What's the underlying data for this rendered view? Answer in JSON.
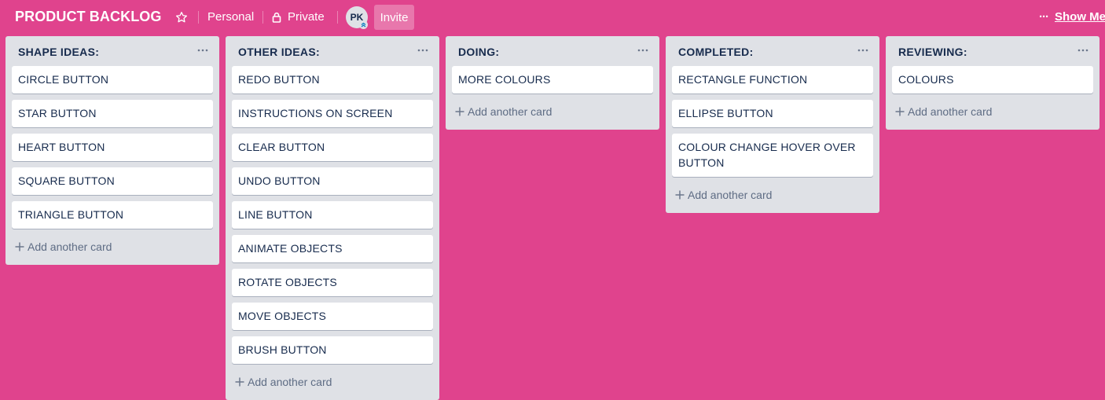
{
  "header": {
    "board_title": "PRODUCT BACKLOG",
    "personal_label": "Personal",
    "private_label": "Private",
    "avatar_initials": "PK",
    "invite_label": "Invite",
    "show_menu_label": "Show Me",
    "menu_dots": "···"
  },
  "colors": {
    "board_background": "#e0438d",
    "list_background": "#dfe1e6",
    "card_background": "#ffffff",
    "card_text": "#172b4d"
  },
  "add_card_label": "Add another card",
  "lists": [
    {
      "title": "SHAPE IDEAS:",
      "cards": [
        "CIRCLE BUTTON",
        "STAR BUTTON",
        "HEART BUTTON",
        "SQUARE BUTTON",
        "TRIANGLE BUTTON"
      ]
    },
    {
      "title": "OTHER IDEAS:",
      "cards": [
        "REDO BUTTON",
        "INSTRUCTIONS ON SCREEN",
        "CLEAR BUTTON",
        "UNDO BUTTON",
        "LINE BUTTON",
        "ANIMATE OBJECTS",
        "ROTATE OBJECTS",
        "MOVE OBJECTS",
        "BRUSH BUTTON"
      ]
    },
    {
      "title": "DOING:",
      "cards": [
        "MORE COLOURS"
      ]
    },
    {
      "title": "COMPLETED:",
      "cards": [
        "RECTANGLE FUNCTION",
        "ELLIPSE BUTTON",
        "COLOUR CHANGE HOVER OVER BUTTON"
      ]
    },
    {
      "title": "REVIEWING:",
      "cards": [
        "COLOURS"
      ]
    }
  ]
}
